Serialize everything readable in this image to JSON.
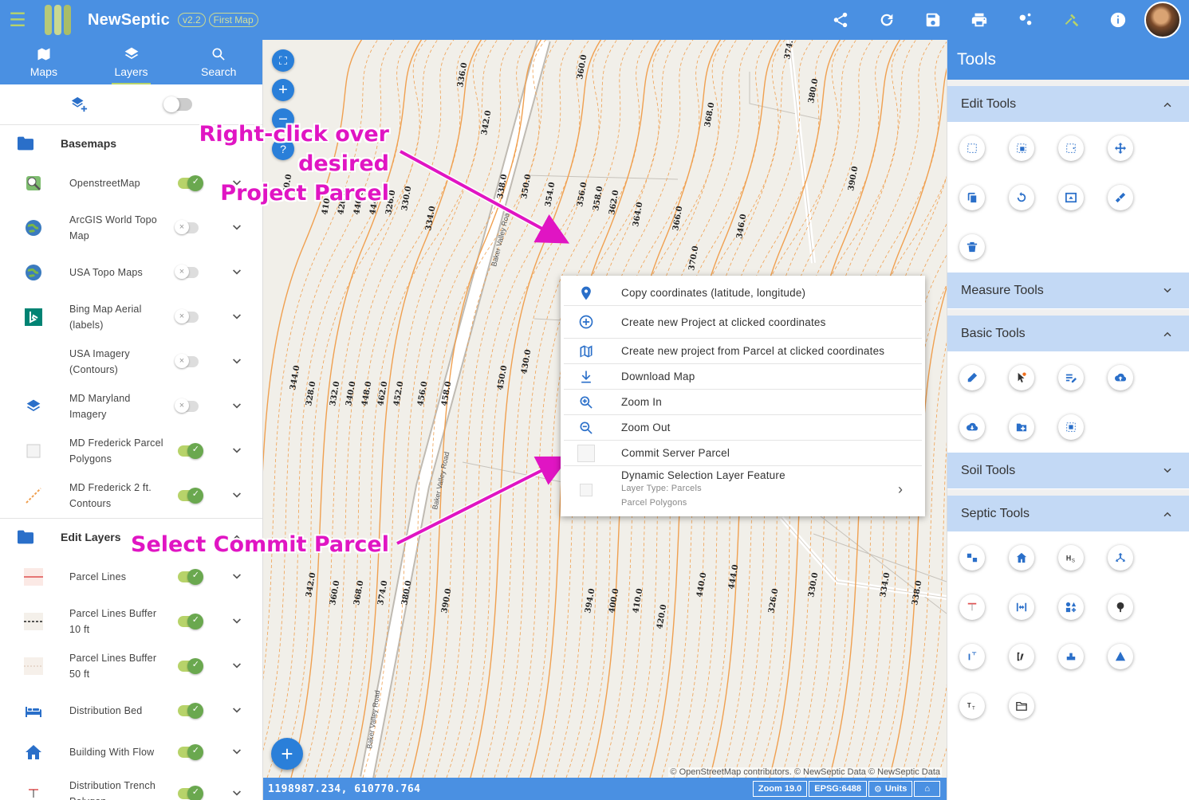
{
  "app": {
    "name": "NewSeptic",
    "version": "v2.2",
    "map_name": "First Map"
  },
  "topbar": {
    "actions": [
      "share-icon",
      "refresh-icon",
      "save-icon",
      "print-icon",
      "settings-icon",
      "tools-icon",
      "info-icon"
    ]
  },
  "left_tabs": [
    {
      "label": "Maps",
      "icon": "map-icon"
    },
    {
      "label": "Layers",
      "icon": "layers-icon"
    },
    {
      "label": "Search",
      "icon": "search-icon"
    }
  ],
  "basemaps": {
    "label": "Basemaps",
    "items": [
      {
        "label": "OpenstreetMap",
        "on": true
      },
      {
        "label": "ArcGIS World Topo Map",
        "on": false
      },
      {
        "label": "USA Topo Maps",
        "on": false
      },
      {
        "label": "Bing Map Aerial (labels)",
        "on": false
      },
      {
        "label": "USA Imagery (Contours)",
        "on": false
      },
      {
        "label": "MD Maryland Imagery",
        "on": false
      },
      {
        "label": "MD Frederick Parcel Polygons",
        "on": true
      },
      {
        "label": "MD Frederick 2 ft. Contours",
        "on": true
      }
    ]
  },
  "edit_layers": {
    "label": "Edit Layers",
    "items": [
      {
        "label": "Parcel Lines",
        "on": true
      },
      {
        "label": "Parcel Lines Buffer 10 ft",
        "on": true
      },
      {
        "label": "Parcel Lines Buffer 50 ft",
        "on": true
      },
      {
        "label": "Distribution Bed",
        "on": true
      },
      {
        "label": "Building With Flow",
        "on": true
      },
      {
        "label": "Distribution Trench Polygon",
        "on": true
      }
    ]
  },
  "context_menu": {
    "items": [
      "Copy coordinates (latitude, longitude)",
      "Create new Project at clicked coordinates",
      "Create new project from Parcel at clicked coordinates",
      "Download Map",
      "Zoom In",
      "Zoom Out",
      "Commit Server Parcel"
    ],
    "dynamic": {
      "title": "Dynamic Selection Layer Feature",
      "layer_type": "Layer Type: Parcels",
      "layer_name": "Parcel Polygons"
    }
  },
  "annotations": {
    "top": "Right-click over desired Project Parcel",
    "top_line1": "Right-click over desired",
    "top_line2": "Project Parcel",
    "bottom": "Select Commit Parcel",
    "color": "#e015c3"
  },
  "map": {
    "road_label": "Baker Valley Road",
    "contour_color": "#f0a050",
    "contour_labels": [
      "336.0",
      "342.0",
      "360.0",
      "368.0",
      "374.0",
      "380.0",
      "390.0",
      "394.0",
      "400.0",
      "410.0",
      "420.0",
      "440.0",
      "444.0",
      "326.0",
      "330.0",
      "334.0",
      "338.0",
      "350.0",
      "354.0",
      "356.0",
      "358.0",
      "362.0",
      "364.0",
      "366.0",
      "370.0",
      "346.0",
      "344.0",
      "328.0",
      "332.0",
      "340.0",
      "448.0",
      "462.0",
      "452.0",
      "456.0",
      "458.0",
      "450.0",
      "430.0"
    ],
    "attribution": "© OpenStreetMap contributors. © NewSeptic Data © NewSeptic Data"
  },
  "status": {
    "coords": "1198987.234, 610770.764",
    "zoom": "Zoom 19.0",
    "epsg": "EPSG:6488",
    "units": "Units"
  },
  "tools": {
    "title": "Tools",
    "sections": [
      {
        "label": "Edit Tools",
        "expanded": true
      },
      {
        "label": "Measure Tools",
        "expanded": false
      },
      {
        "label": "Basic Tools",
        "expanded": true
      },
      {
        "label": "Soil Tools",
        "expanded": false
      },
      {
        "label": "Septic Tools",
        "expanded": true
      }
    ]
  }
}
